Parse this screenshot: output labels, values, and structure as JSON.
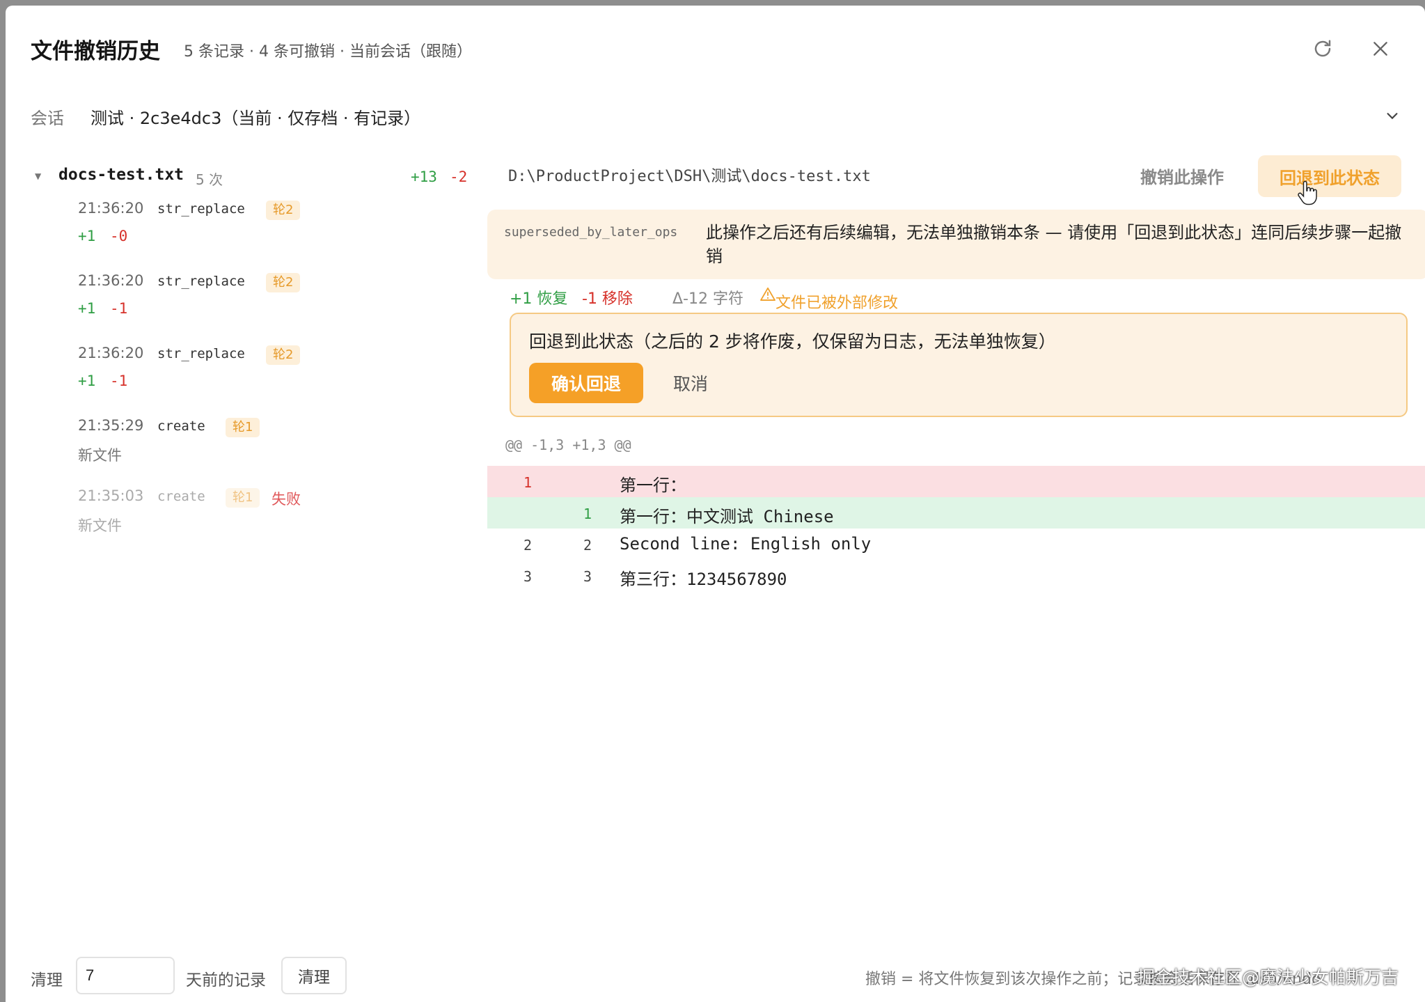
{
  "header": {
    "title": "文件撤销历史",
    "subtitle": "5 条记录 · 4 条可撤销 · 当前会话（跟随）"
  },
  "session": {
    "label": "会话",
    "value": "测试 · 2c3e4dc3（当前 · 仅存档 · 有记录）"
  },
  "file": {
    "name": "docs-test.txt",
    "count": "5 次",
    "added": "+13",
    "removed": "-2"
  },
  "operations": [
    {
      "time": "21:36:20",
      "kind": "str_replace",
      "round": "轮2",
      "added": "+1",
      "removed": "-0"
    },
    {
      "time": "21:36:20",
      "kind": "str_replace",
      "round": "轮2",
      "added": "+1",
      "removed": "-1"
    },
    {
      "time": "21:36:20",
      "kind": "str_replace",
      "round": "轮2",
      "added": "+1",
      "removed": "-1"
    },
    {
      "time": "21:35:29",
      "kind": "create",
      "round": "轮1",
      "note": "新文件"
    },
    {
      "time": "21:35:03",
      "kind": "create",
      "round": "轮1",
      "status": "失败",
      "note": "新文件"
    }
  ],
  "detail": {
    "path": "D:\\ProductProject\\DSH\\测试\\docs-test.txt",
    "undo_label": "撤销此操作",
    "revert_label": "回退到此状态",
    "warning_code": "superseded_by_later_ops",
    "warning_text": "此操作之后还有后续编辑，无法单独撤销本条 — 请使用「回退到此状态」连同后续步骤一起撤销",
    "stats": {
      "restore": "+1 恢复",
      "remove": "-1 移除",
      "delta": "Δ-12 字符",
      "modified": "文件已被外部修改"
    },
    "confirm": {
      "text": "回退到此状态（之后的 2 步将作废，仅保留为日志，无法单独恢复）",
      "confirm_label": "确认回退",
      "cancel_label": "取消"
    },
    "diff": {
      "hunk": "@@ -1,3 +1,3 @@",
      "lines": [
        {
          "type": "del",
          "old": "1",
          "new": "",
          "text": "第一行："
        },
        {
          "type": "add",
          "old": "",
          "new": "1",
          "text": "第一行：中文测试 Chinese"
        },
        {
          "type": "ctx",
          "old": "2",
          "new": "2",
          "text": "Second line: English only"
        },
        {
          "type": "ctx",
          "old": "3",
          "new": "3",
          "text": "第三行：1234567890"
        }
      ]
    }
  },
  "footer": {
    "label_prefix": "清理",
    "days_value": "7",
    "label_suffix": "天前的记录",
    "clean_label": "清理",
    "hint": "撤销 = 将文件恢复到该次操作之前；记录按会话保存在 .dsh/undo",
    "watermark": "掘金技术社区@魔法少女帕斯万吉"
  },
  "colors": {
    "accent": "#f5a027",
    "added": "#2f9e44",
    "removed": "#d6312a",
    "warning_bg": "#fdf2e3"
  }
}
